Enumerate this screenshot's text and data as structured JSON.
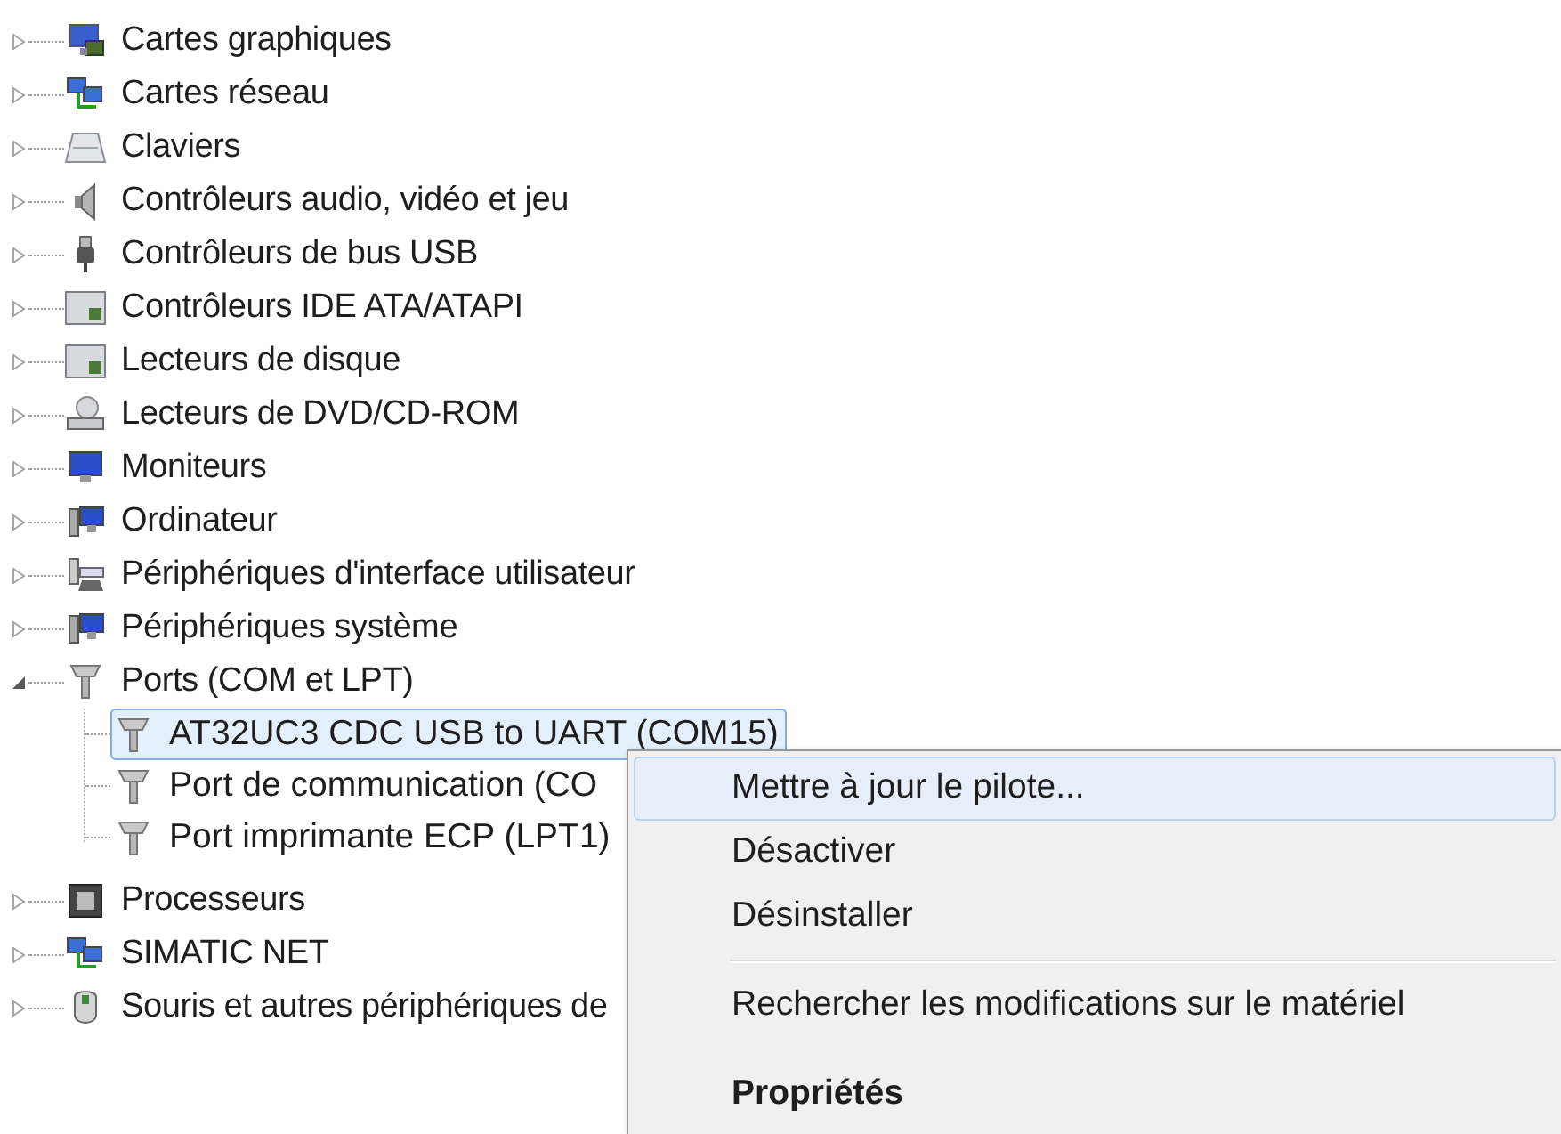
{
  "tree": [
    {
      "label": "Cartes graphiques",
      "kind": "display",
      "expanded": false
    },
    {
      "label": "Cartes réseau",
      "kind": "network",
      "expanded": false
    },
    {
      "label": "Claviers",
      "kind": "keyboard",
      "expanded": false
    },
    {
      "label": "Contrôleurs audio, vidéo et jeu",
      "kind": "audio",
      "expanded": false
    },
    {
      "label": "Contrôleurs de bus USB",
      "kind": "usb",
      "expanded": false
    },
    {
      "label": "Contrôleurs IDE ATA/ATAPI",
      "kind": "drive",
      "expanded": false
    },
    {
      "label": "Lecteurs de disque",
      "kind": "drive",
      "expanded": false
    },
    {
      "label": "Lecteurs de DVD/CD-ROM",
      "kind": "dvd",
      "expanded": false
    },
    {
      "label": "Moniteurs",
      "kind": "monitor",
      "expanded": false
    },
    {
      "label": "Ordinateur",
      "kind": "computer",
      "expanded": false
    },
    {
      "label": "Périphériques d'interface utilisateur",
      "kind": "hid",
      "expanded": false
    },
    {
      "label": "Périphériques système",
      "kind": "computer",
      "expanded": false
    },
    {
      "label": "Ports (COM et LPT)",
      "kind": "port",
      "expanded": true,
      "children": [
        {
          "label": "AT32UC3 CDC USB to UART (COM15)",
          "kind": "port",
          "selected": true
        },
        {
          "label": "Port de communication (CO",
          "kind": "port",
          "selected": false
        },
        {
          "label": "Port imprimante ECP (LPT1)",
          "kind": "port",
          "selected": false
        }
      ]
    },
    {
      "label": "Processeurs",
      "kind": "chip",
      "expanded": false
    },
    {
      "label": "SIMATIC NET",
      "kind": "network",
      "expanded": false
    },
    {
      "label": "Souris et autres périphériques de",
      "kind": "mouse",
      "expanded": false
    }
  ],
  "context_menu": {
    "items": [
      {
        "kind": "item",
        "label": "Mettre à jour le pilote...",
        "selected": true,
        "default": false
      },
      {
        "kind": "item",
        "label": "Désactiver",
        "selected": false,
        "default": false
      },
      {
        "kind": "item",
        "label": "Désinstaller",
        "selected": false,
        "default": false
      },
      {
        "kind": "separator"
      },
      {
        "kind": "item",
        "label": "Rechercher les modifications sur le matériel",
        "selected": false,
        "default": false
      },
      {
        "kind": "item",
        "label": "Propriétés",
        "selected": false,
        "default": true
      }
    ]
  }
}
